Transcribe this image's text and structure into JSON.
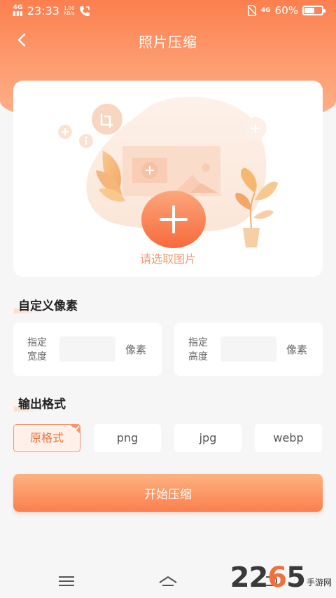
{
  "status_bar": {
    "signal": "4G",
    "time": "23:33",
    "net_speed_value": "1.00",
    "net_speed_unit": "KB/s",
    "network_right": "4G",
    "battery_text": "60%",
    "battery_level": 0.6
  },
  "header": {
    "title": "照片压缩"
  },
  "upload": {
    "label": "请选取图片"
  },
  "custom_pixels": {
    "title": "自定义像素",
    "width_label": "指定宽度",
    "height_label": "指定高度",
    "width_value": "",
    "height_value": "",
    "unit": "像素"
  },
  "output_format": {
    "title": "输出格式",
    "options": [
      "原格式",
      "png",
      "jpg",
      "webp"
    ],
    "selected": "原格式"
  },
  "start_button": {
    "label": "开始压缩"
  },
  "watermark": {
    "number_prefix": "22",
    "number_mid": "6",
    "number_suffix": "5",
    "text": "手游网"
  },
  "colors": {
    "accent": "#fb7f4e",
    "accent_light": "#fdb281",
    "selected_bg": "#fff1ea"
  }
}
